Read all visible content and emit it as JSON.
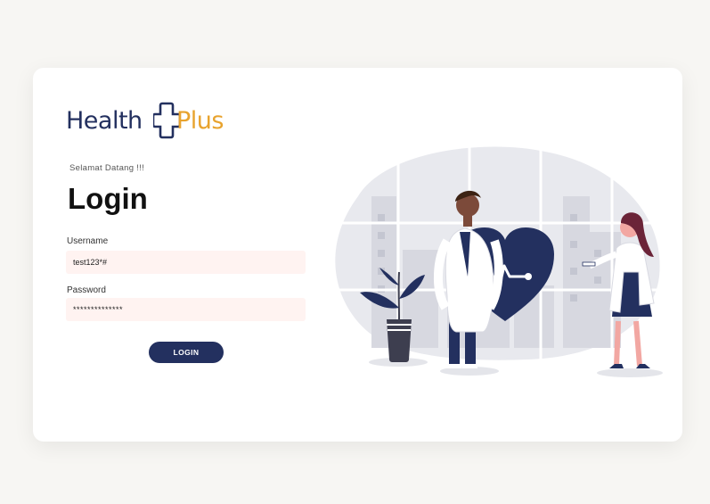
{
  "brand": {
    "part1": "Health",
    "part2": "Plus",
    "primary_color": "#23305f",
    "accent_color": "#e8a32e"
  },
  "form": {
    "welcome_text": "Selamat Datang !!!",
    "title": "Login",
    "username_label": "Username",
    "username_value": "test123*#",
    "password_label": "Password",
    "password_value": "**************",
    "login_button": "LOGIN",
    "field_background": "#fff3f1"
  },
  "illustration": {
    "icon": "heart-pulse-icon",
    "figures": [
      "male-doctor",
      "female-doctor",
      "potted-plant",
      "city-window"
    ]
  }
}
